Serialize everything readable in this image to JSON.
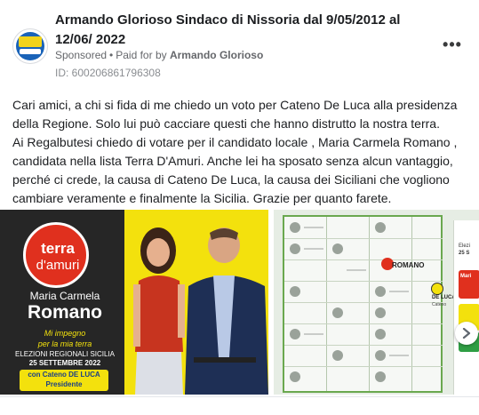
{
  "post": {
    "page_name": "Armando Glorioso Sindaco di Nissoria dal 9/05/2012 al 12/06/ 2022",
    "sponsored_label": "Sponsored",
    "separator": "•",
    "paid_for_prefix": "Paid for by",
    "payer": "Armando Glorioso",
    "ad_id": "ID: 600206861796308",
    "more_icon": "more-horizontal-icon",
    "body": [
      "Cari amici, a chi si fida di me chiedo un voto per Cateno De Luca alla presidenza della Regione. Solo lui può cacciare questi che hanno distrutto la nostra terra.",
      "Ai Regalbutesi chiedo di votare per il candidato locale , Maria Carmela Romano , candidata nella lista Terra D'Amuri. Anche lei ha sposato senza alcun vantaggio, perché ci crede, la causa di Cateno De Luca, la causa dei Siciliani che vogliono cambiare veramente e finalmente la Sicilia. Grazie per quanto farete."
    ]
  },
  "creative_left": {
    "logo_line1": "terra",
    "logo_line2": "d'amuri",
    "candidate_first": "Maria Carmela",
    "candidate_last": "Romano",
    "slogan_line1": "Mi impegno",
    "slogan_line2": "per la mia terra",
    "election_line1": "ELEZIONI REGIONALI SICILIA",
    "election_line2": "25 SETTEMBRE 2022",
    "badge_line1": "con Cateno DE LUCA",
    "badge_line2": "Presidente"
  },
  "creative_right": {
    "ballot_name": "ROMANO",
    "deluca_name": "DE LUCA",
    "deluca_sub": "Cateno",
    "side_text1": "Elezi",
    "side_text2": "25 S",
    "side_red_text": "Mari",
    "side_green_text": "S"
  },
  "colors": {
    "brand_red": "#e0301e",
    "brand_yellow": "#f3e10d",
    "ballot_green": "#6aa84f",
    "text_primary": "#1c1e21",
    "text_secondary": "#65676b"
  },
  "next_icon": "chevron-right-icon"
}
